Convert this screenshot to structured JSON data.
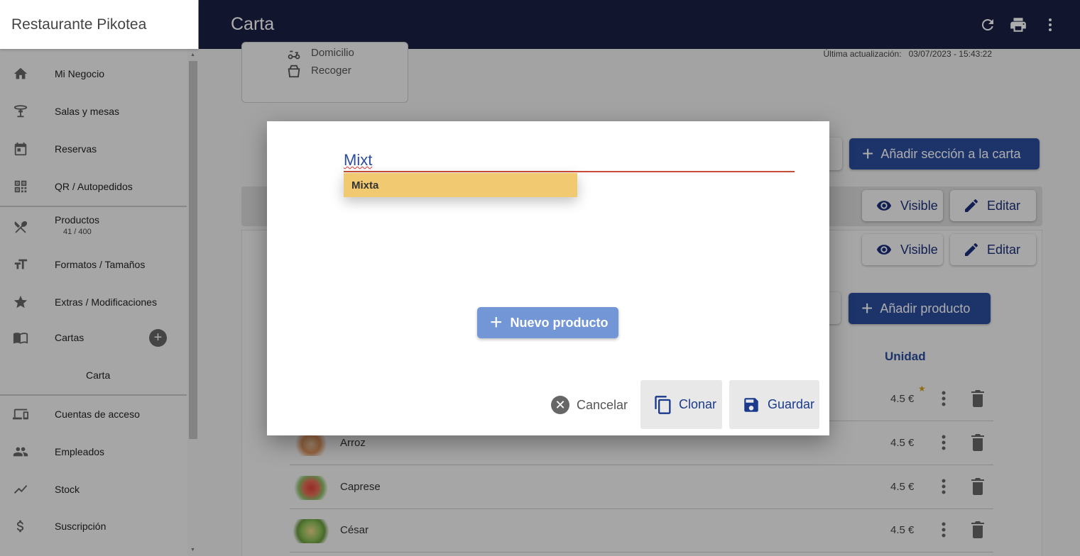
{
  "sidebar": {
    "restaurant_name": "Restaurante Pikotea",
    "items": [
      {
        "label": "Mi Negocio",
        "icon": "home-icon"
      },
      {
        "label": "Salas y mesas",
        "icon": "table-icon"
      },
      {
        "label": "Reservas",
        "icon": "calendar-icon"
      },
      {
        "label": "QR / Autopedidos",
        "icon": "qr-icon"
      },
      {
        "label": "Productos",
        "sub": "41 / 400",
        "icon": "utensils-icon"
      },
      {
        "label": "Formatos / Tamaños",
        "icon": "text-size-icon"
      },
      {
        "label": "Extras / Modificaciones",
        "icon": "star-icon"
      },
      {
        "label": "Cartas",
        "icon": "menu-book-icon"
      },
      {
        "label": "Carta"
      },
      {
        "label": "Cuentas de acceso",
        "icon": "devices-icon"
      },
      {
        "label": "Empleados",
        "icon": "people-icon"
      },
      {
        "label": "Stock",
        "icon": "trending-icon"
      },
      {
        "label": "Suscripción",
        "icon": "dollar-icon"
      }
    ]
  },
  "topbar": {
    "title": "Carta",
    "icons": [
      "refresh-icon",
      "print-icon",
      "more-vert-icon"
    ]
  },
  "main": {
    "delivery": {
      "domicilio": "Domicilio",
      "recoger": "Recoger"
    },
    "last_update_label": "Última actualización:",
    "last_update_value": "03/07/2023 - 15:43:22",
    "add_section_label": "Añadir sección a la carta",
    "visible_label": "Visible",
    "edit_label": "Editar",
    "add_product_label": "Añadir producto",
    "col_unit": "Unidad",
    "products": [
      {
        "name": "",
        "price": "4.5 €",
        "featured": true
      },
      {
        "name": "Arroz",
        "price": "4.5 €"
      },
      {
        "name": "Caprese",
        "price": "4.5 €"
      },
      {
        "name": "César",
        "price": "4.5 €"
      }
    ]
  },
  "dialog": {
    "input_value": "Mixt",
    "suggestion": "Mixta",
    "new_product_label": "Nuevo producto",
    "cancel_label": "Cancelar",
    "clone_label": "Clonar",
    "save_label": "Guardar"
  },
  "colors": {
    "topbar": "#1b2045",
    "accent": "#2c4d9e",
    "suggestion": "#f0c970",
    "new_button": "#7396d6"
  }
}
